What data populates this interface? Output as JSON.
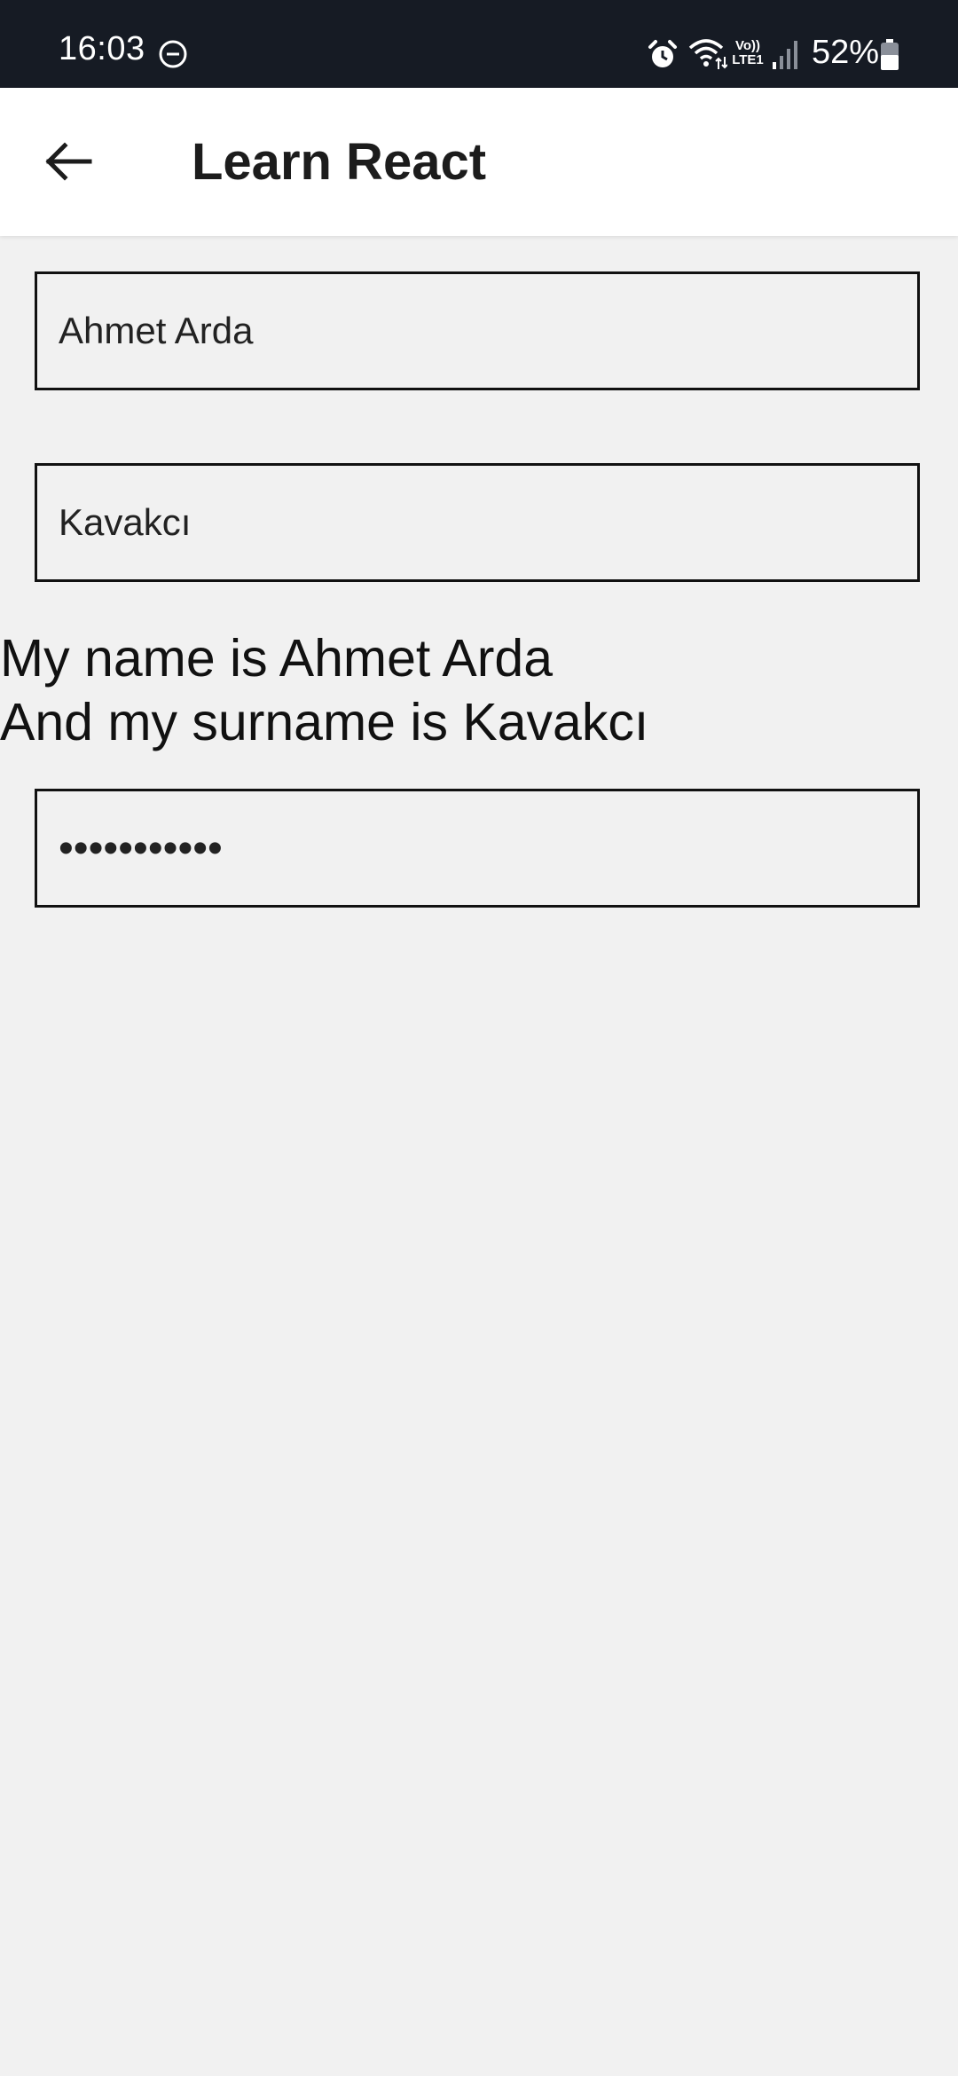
{
  "status_bar": {
    "time": "16:03",
    "volte_label_top": "Vo))",
    "volte_label_bottom": "LTE1",
    "battery": "52%",
    "icons": [
      "do-not-disturb-icon",
      "alarm-icon",
      "wifi-icon",
      "volte-icon",
      "signal-icon",
      "battery-icon"
    ]
  },
  "app_bar": {
    "title": "Learn React",
    "back_icon": "arrow-left-icon"
  },
  "form": {
    "first_name_value": "Ahmet Arda",
    "last_name_value": "Kavakcı",
    "password_masked": "•••••••••••"
  },
  "output": {
    "line_1": "My name is Ahmet Arda",
    "line_2": "And my surname is Kavakcı"
  },
  "colors": {
    "status_bar_bg": "#161b24",
    "app_bar_bg": "#ffffff",
    "page_bg": "#f1f1f1",
    "border": "#111111"
  }
}
